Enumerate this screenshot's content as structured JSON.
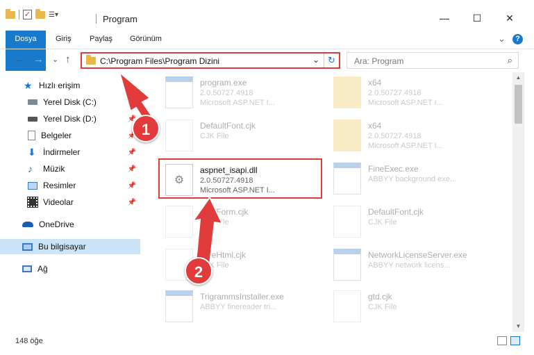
{
  "window": {
    "title": "Program",
    "minimize": "—",
    "maximize": "☐",
    "close": "✕"
  },
  "ribbon": {
    "tabs": [
      "Dosya",
      "Giriş",
      "Paylaş",
      "Görünüm"
    ],
    "expand": "⌄",
    "help": "?"
  },
  "nav": {
    "back": "←",
    "forward": "→",
    "recent": "⌄",
    "up": "↑",
    "address": "C:\\Program Files\\Program Dizini",
    "dropdown": "⌄",
    "refresh": "↻",
    "search_placeholder": "Ara: Program",
    "search_icon": "⌕"
  },
  "sidebar": [
    {
      "label": "Hızlı erişim",
      "icon": "star-icon",
      "pinned": false
    },
    {
      "label": "Yerel Disk (C:)",
      "icon": "drive-icon",
      "pinned": true
    },
    {
      "label": "Yerel Disk (D:)",
      "icon": "drive-icon",
      "pinned": true
    },
    {
      "label": "Belgeler",
      "icon": "document-icon",
      "pinned": true
    },
    {
      "label": "İndirmeler",
      "icon": "download-icon",
      "pinned": true
    },
    {
      "label": "Müzik",
      "icon": "music-icon",
      "pinned": true
    },
    {
      "label": "Resimler",
      "icon": "picture-icon",
      "pinned": true
    },
    {
      "label": "Videolar",
      "icon": "video-icon",
      "pinned": true
    },
    {
      "label": "OneDrive",
      "icon": "cloud-icon",
      "pinned": false
    },
    {
      "label": "Bu bilgisayar",
      "icon": "computer-icon",
      "pinned": false,
      "selected": true
    },
    {
      "label": "Ağ",
      "icon": "network-icon",
      "pinned": false
    }
  ],
  "files": [
    {
      "name": "program.exe",
      "l2": "2.0.50727.4918",
      "l3": "Microsoft ASP.NET I...",
      "kind": "app"
    },
    {
      "name": "x64",
      "l2": "2.0.50727.4918",
      "l3": "Microsoft ASP.NET I...",
      "kind": "folder"
    },
    {
      "name": "DefaultFont.cjk",
      "l2": "CJK File",
      "l3": "",
      "kind": "doc"
    },
    {
      "name": "x64",
      "l2": "2.0.50727.4918",
      "l3": "Microsoft ASP.NET I...",
      "kind": "folder"
    },
    {
      "name": "aspnet_isapi.dll",
      "l2": "2.0.50727.4918",
      "l3": "Microsoft ASP.NET I...",
      "kind": "dll"
    },
    {
      "name": "FineExec.exe",
      "l2": "ABBYY background exe...",
      "l3": "",
      "kind": "app"
    },
    {
      "name": "FineForm.cjk",
      "l2": "CJK File",
      "l3": "",
      "kind": "doc"
    },
    {
      "name": "DefaultFont.cjk",
      "l2": "CJK File",
      "l3": "",
      "kind": "doc"
    },
    {
      "name": "FineHtml.cjk",
      "l2": "CJK File",
      "l3": "",
      "kind": "doc"
    },
    {
      "name": "NetworkLicenseServer.exe",
      "l2": "ABBYY network licens...",
      "l3": "",
      "kind": "app"
    },
    {
      "name": "TrigrammsInstaller.exe",
      "l2": "ABBYY finereader tri...",
      "l3": "",
      "kind": "app"
    },
    {
      "name": "gtd.cjk",
      "l2": "CJK File",
      "l3": "",
      "kind": "doc"
    }
  ],
  "status": {
    "count": "148 öğe"
  },
  "annotations": {
    "step1": "1",
    "step2": "2"
  },
  "colors": {
    "accent": "#1979ca",
    "highlight": "#e03a3a"
  }
}
